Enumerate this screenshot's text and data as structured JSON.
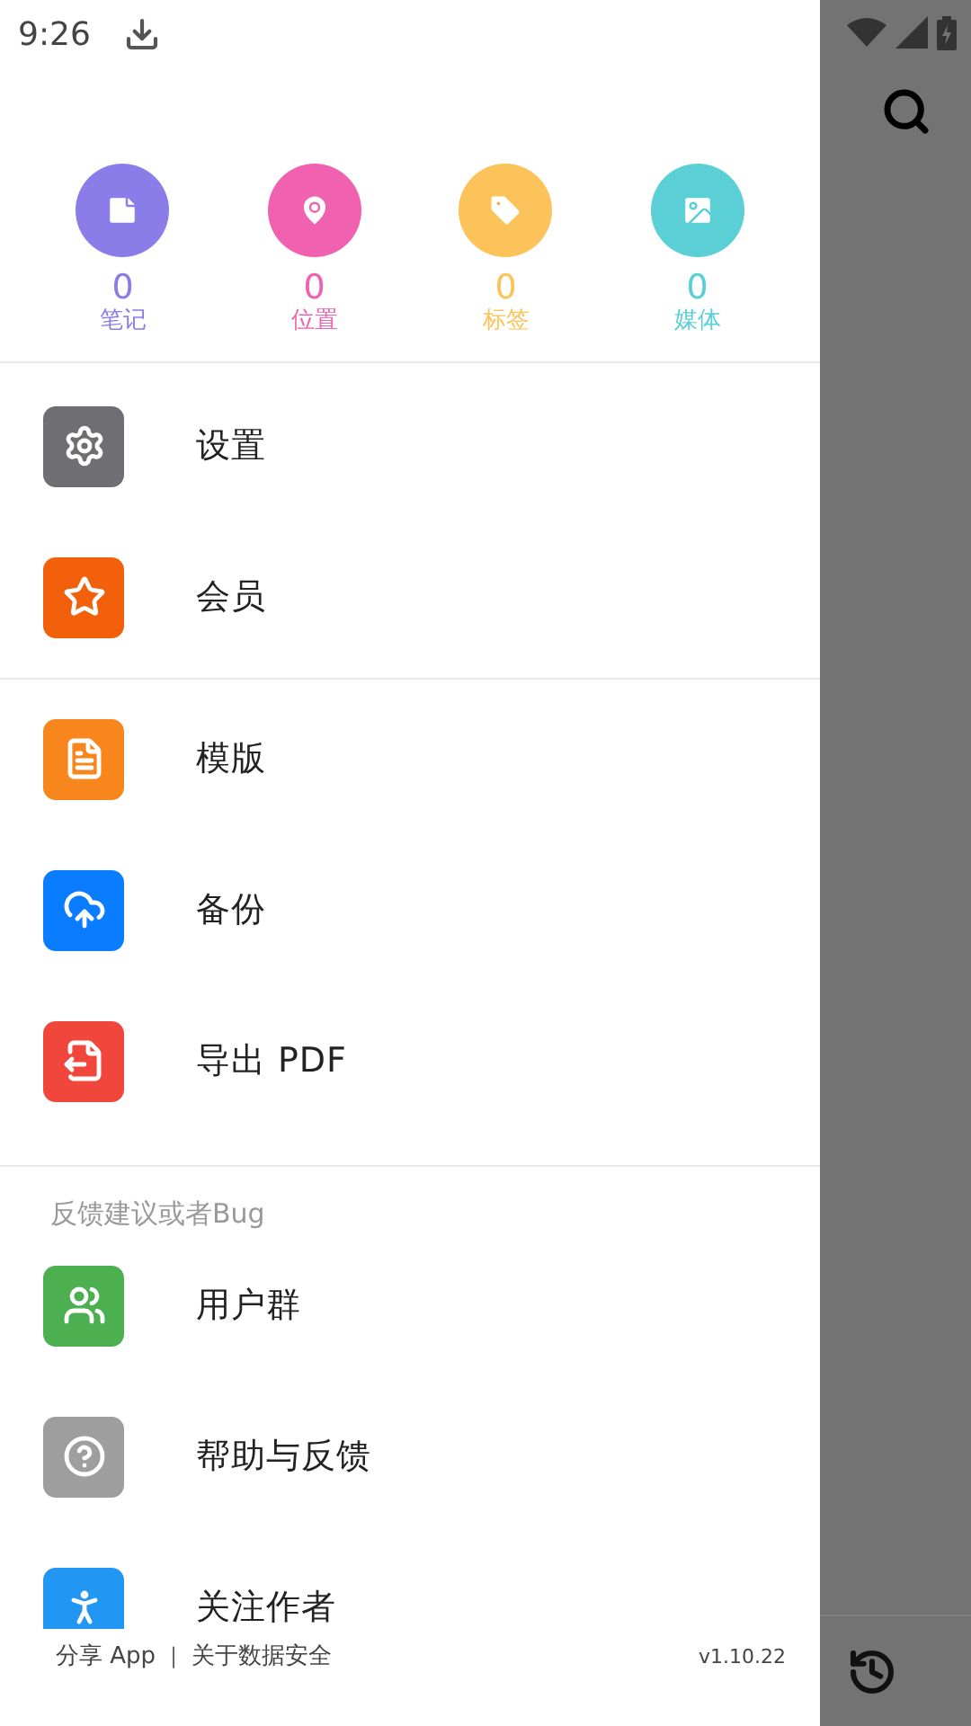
{
  "status_bar": {
    "time": "9:26"
  },
  "stats": [
    {
      "kind": "notes",
      "count": "0",
      "label": "笔记",
      "color": "#8a7de8"
    },
    {
      "kind": "location",
      "count": "0",
      "label": "位置",
      "color": "#f062b0"
    },
    {
      "kind": "tags",
      "count": "0",
      "label": "标签",
      "color": "#fcc35a"
    },
    {
      "kind": "media",
      "count": "0",
      "label": "媒体",
      "color": "#5bcfd6"
    }
  ],
  "menu_groups": [
    {
      "items": [
        {
          "kind": "settings",
          "label": "设置",
          "color": "#6e6e73"
        },
        {
          "kind": "member",
          "label": "会员",
          "color": "#f2600c"
        }
      ]
    },
    {
      "items": [
        {
          "kind": "template",
          "label": "模版",
          "color": "#f7861d"
        },
        {
          "kind": "backup",
          "label": "备份",
          "color": "#0a7cff"
        },
        {
          "kind": "pdf",
          "label": "导出 PDF",
          "color": "#f0463c"
        }
      ]
    },
    {
      "header": "反馈建议或者Bug",
      "items": [
        {
          "kind": "group",
          "label": "用户群",
          "color": "#4caf50"
        },
        {
          "kind": "help",
          "label": "帮助与反馈",
          "color": "#9e9e9e"
        },
        {
          "kind": "follow",
          "label": "关注作者",
          "color": "#2196f3"
        }
      ]
    }
  ],
  "footer": {
    "links": [
      "分享 App",
      "关于数据安全"
    ],
    "separator": "|",
    "version": "v1.10.22"
  }
}
